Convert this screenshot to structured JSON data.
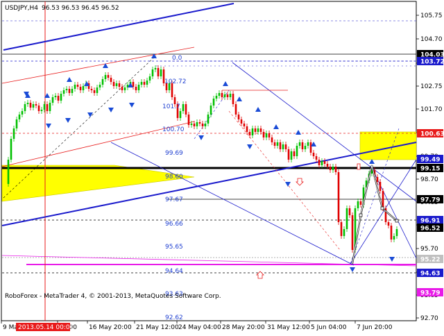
{
  "header": {
    "symbol_tf": "USDJPY,H4",
    "ohlc": "96.53 96.53 96.45 96.52"
  },
  "footer": {
    "copyright": "RoboForex - MetaTrader 4, © 2001-2013, MetaQuotes Software Corp."
  },
  "price_axis": {
    "ticks": [
      "105.75",
      "104.70",
      "103.65",
      "102.75",
      "101.70",
      "100.75",
      "99.70",
      "98.70",
      "97.65",
      "96.70",
      "95.70",
      "94.65",
      "93.65",
      "92.70"
    ],
    "tags": [
      {
        "label": "104.03",
        "bg": "#000000",
        "fg": "#ffffff"
      },
      {
        "label": "103.72",
        "bg": "#1a1acc",
        "fg": "#ffffff"
      },
      {
        "label": "100.63",
        "bg": "#e81b1b",
        "fg": "#ffffff"
      },
      {
        "label": "99.49",
        "bg": "#1a1acc",
        "fg": "#ffffff"
      },
      {
        "label": "99.15",
        "bg": "#000000",
        "fg": "#ffffff"
      },
      {
        "label": "97.79",
        "bg": "#000000",
        "fg": "#ffffff"
      },
      {
        "label": "96.91",
        "bg": "#1a1acc",
        "fg": "#ffffff"
      },
      {
        "label": "96.52",
        "bg": "#000000",
        "fg": "#ffffff"
      },
      {
        "label": "95.22",
        "bg": "#c0c0c0",
        "fg": "#ffffff"
      },
      {
        "label": "94.63",
        "bg": "#1a1acc",
        "fg": "#ffffff"
      },
      {
        "label": "93.79",
        "bg": "#e81be8",
        "fg": "#ffffff"
      }
    ]
  },
  "time_axis": {
    "labels": [
      "9 May 2013",
      "04:00",
      "16 May 20:00",
      "21 May 12:00",
      "24 May 04:00",
      "28 May 20:00",
      "31 May 12:00",
      "5 Jun 04:00",
      "7 Jun 20:00"
    ],
    "highlight": "2013.05.14 00:00"
  },
  "fibo_levels": [
    "0.0",
    "102.72",
    "101.7",
    "100.70",
    "99.69",
    "98.60",
    "97.67",
    "96.66",
    "95.65",
    "94.64",
    "93.63",
    "92.62"
  ],
  "colors": {
    "bull": "#00c000",
    "bear": "#e00000",
    "trend_blue": "#1a1acc",
    "support_magenta": "#e81be8",
    "zone_yellow": "#ffff00"
  }
}
